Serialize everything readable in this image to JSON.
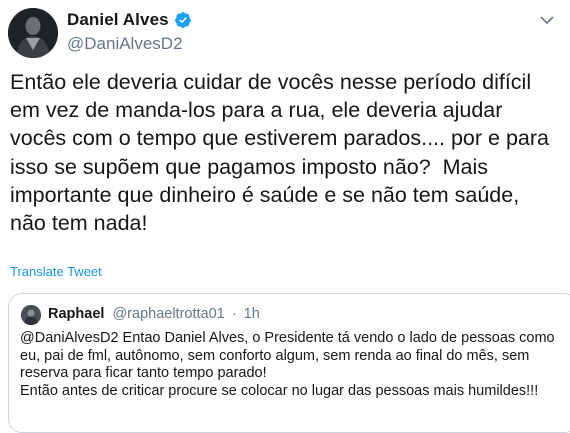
{
  "author": {
    "display_name": "Daniel Alves",
    "handle": "@DaniAlvesD2",
    "verified": true
  },
  "tweet": {
    "text": "Então ele deveria cuidar de vocês nesse período difícil\nem vez de manda-los para a rua, ele deveria ajudar\nvocês com o tempo que estiverem parados.... por e para\nisso se supõem que pagamos imposto não?  Mais\nimportante que dinheiro é saúde e se não tem saúde,\nnão tem nada!",
    "translate_label": "Translate Tweet"
  },
  "quoted": {
    "display_name": "Raphael",
    "handle": "@raphaeltrotta01",
    "separator": "·",
    "time": "1h",
    "text": "@DaniAlvesD2 Entao Daniel Alves, o Presidente tá vendo o lado de pessoas como\neu, pai de fml, autônomo, sem conforto algum, sem renda ao final do mês, sem\nreserva para ficar tanto tempo parado!\nEntão antes de criticar procure se colocar no lugar das pessoas mais humildes!!!"
  },
  "icons": {
    "verified": "verified-badge-icon",
    "more": "chevron-down-icon"
  },
  "colors": {
    "link": "#1b95e0",
    "verified": "#1da1f2",
    "secondary_text": "#657786",
    "border": "#ccd6dd"
  }
}
